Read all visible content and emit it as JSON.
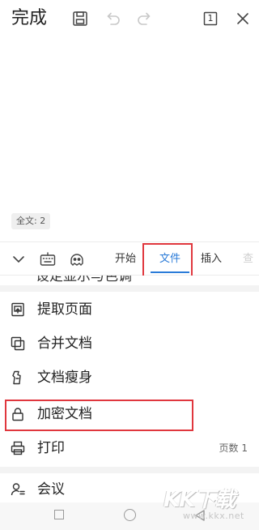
{
  "toolbar": {
    "done_label": "完成",
    "page_badge": "1"
  },
  "document": {
    "word_count": "全文: 2"
  },
  "ribbon": {
    "tabs": [
      {
        "label": "开始"
      },
      {
        "label": "文件",
        "active": true
      },
      {
        "label": "插入"
      },
      {
        "label": "查"
      }
    ]
  },
  "menu": {
    "cutoff_label": "设定显示与色调",
    "items": [
      {
        "icon": "extract-page-icon",
        "label": "提取页面"
      },
      {
        "icon": "merge-document-icon",
        "label": "合并文档"
      },
      {
        "icon": "slim-document-icon",
        "label": "文档瘦身"
      },
      {
        "icon": "lock-icon",
        "label": "加密文档"
      },
      {
        "icon": "printer-icon",
        "label": "打印",
        "extra": "页数 1"
      },
      {
        "icon": "meeting-icon",
        "label": "会议"
      }
    ]
  },
  "watermark": {
    "main": "KK下载",
    "sub": "www.kkx.net"
  },
  "colors": {
    "accent": "#2a7bd8",
    "highlight_box": "#e0373e",
    "separator": "#f3f3f3"
  }
}
